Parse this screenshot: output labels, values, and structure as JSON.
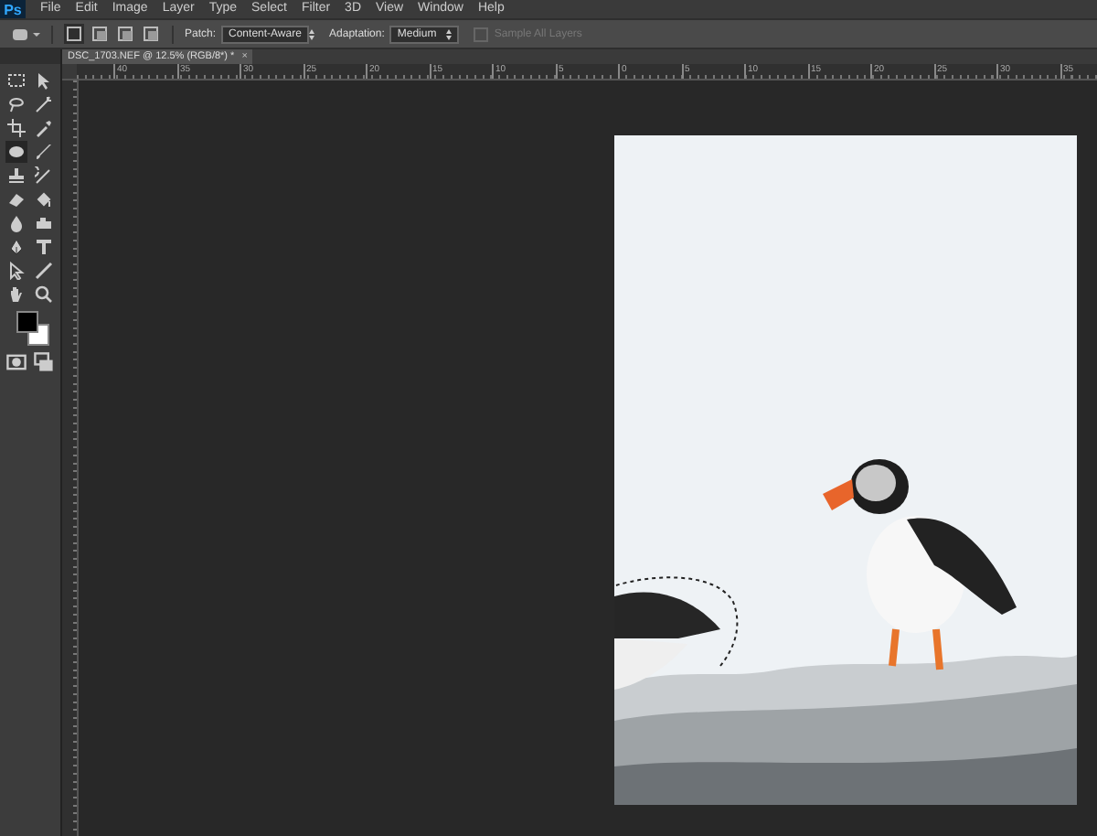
{
  "app_logo": "Ps",
  "menu": [
    "File",
    "Edit",
    "Image",
    "Layer",
    "Type",
    "Select",
    "Filter",
    "3D",
    "View",
    "Window",
    "Help"
  ],
  "options_bar": {
    "modes": [
      {
        "selected": true
      },
      {
        "selected": false
      },
      {
        "selected": false
      },
      {
        "selected": false
      }
    ],
    "patch": {
      "label": "Patch:",
      "value": "Content-Aware"
    },
    "adaptation": {
      "label": "Adaptation:",
      "value": "Medium"
    },
    "sample_all_layers": {
      "label": "Sample All Layers",
      "checked": false,
      "disabled": true
    }
  },
  "document_tab": {
    "title": "DSC_1703.NEF @ 12.5% (RGB/8*) *",
    "close": "×"
  },
  "ruler": {
    "labels": [
      "40",
      "35",
      "30",
      "25",
      "20",
      "15",
      "10",
      "5",
      "0",
      "5",
      "10",
      "15",
      "20",
      "25",
      "30",
      "35"
    ]
  },
  "tools": [
    {
      "kind": "marquee",
      "selected": false
    },
    {
      "kind": "move",
      "selected": false
    },
    {
      "kind": "lasso",
      "selected": false
    },
    {
      "kind": "wand",
      "selected": false
    },
    {
      "kind": "crop",
      "selected": false
    },
    {
      "kind": "eyedropper",
      "selected": false
    },
    {
      "kind": "patch",
      "selected": true
    },
    {
      "kind": "brush",
      "selected": false
    },
    {
      "kind": "stamp",
      "selected": false
    },
    {
      "kind": "history",
      "selected": false
    },
    {
      "kind": "eraser",
      "selected": false
    },
    {
      "kind": "bucket",
      "selected": false
    },
    {
      "kind": "blur",
      "selected": false
    },
    {
      "kind": "dodge",
      "selected": false
    },
    {
      "kind": "pen",
      "selected": false
    },
    {
      "kind": "type",
      "selected": false
    },
    {
      "kind": "pathselect",
      "selected": false
    },
    {
      "kind": "line",
      "selected": false
    },
    {
      "kind": "hand",
      "selected": false
    },
    {
      "kind": "zoom",
      "selected": false
    }
  ]
}
